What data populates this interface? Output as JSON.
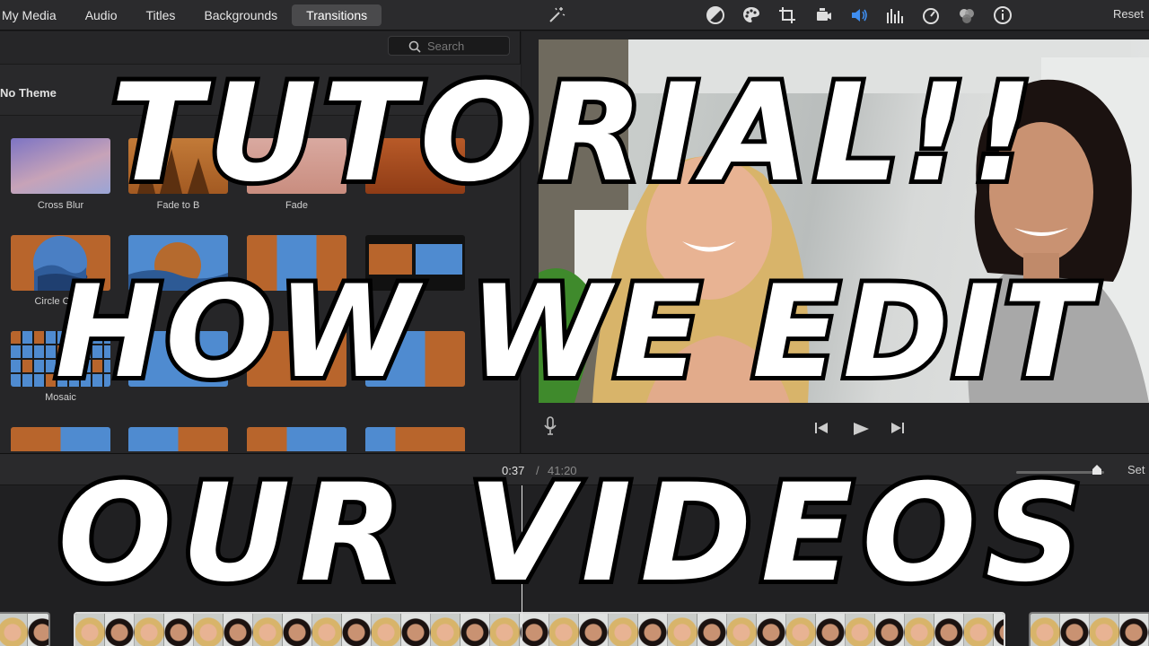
{
  "toolbar": {
    "tabs": [
      "My Media",
      "Audio",
      "Titles",
      "Backgrounds",
      "Transitions"
    ],
    "active_tab": "Transitions",
    "reset_label": "Reset",
    "icons": [
      "magic-wand-icon",
      "color-balance-icon",
      "color-palette-icon",
      "crop-icon",
      "stabilization-icon",
      "volume-icon",
      "equalizer-icon",
      "speed-icon",
      "filter-icon",
      "info-icon"
    ]
  },
  "browser": {
    "search_placeholder": "Search",
    "theme_label": "No Theme",
    "transitions": [
      {
        "label": "Cross Blur"
      },
      {
        "label": "Fade to B"
      },
      {
        "label": "Fade"
      },
      {
        "label": ""
      },
      {
        "label": "Circle Open"
      },
      {
        "label": ""
      },
      {
        "label": ""
      },
      {
        "label": ""
      },
      {
        "label": "Mosaic"
      },
      {
        "label": ""
      },
      {
        "label": ""
      },
      {
        "label": ""
      }
    ]
  },
  "viewer": {
    "icons": [
      "microphone-icon",
      "skip-back-icon",
      "play-icon",
      "skip-forward-icon"
    ]
  },
  "timeline": {
    "current_time": "0:37",
    "separator": "/",
    "total_time": "41:20",
    "settings_label": "Set",
    "zoom_level": 0.92
  },
  "overlay": {
    "line1": "TUTORIAL!!",
    "line2": "HOW WE EDIT",
    "line3": "OUR VIDEOS"
  },
  "colors": {
    "toolbar_bg": "#2b2b2d",
    "panel_bg": "#262628",
    "accent_blue": "#3f8ef0",
    "overlay_text": "#ffffff",
    "overlay_stroke": "#000000"
  }
}
